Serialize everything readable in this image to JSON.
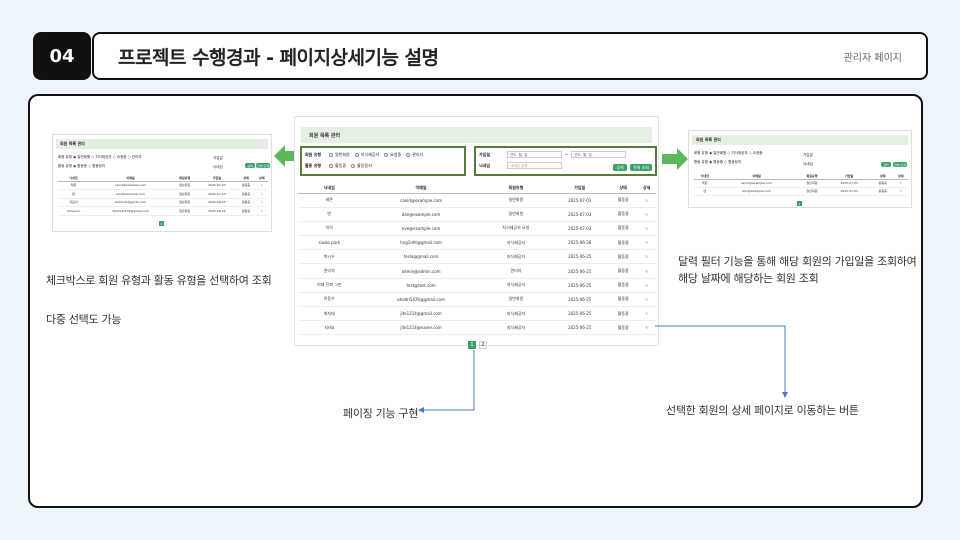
{
  "header": {
    "number": "04",
    "title": "프로젝트 수행경과 - 페이지상세기능 설명",
    "subtitle": "관리자 페이지"
  },
  "screen": {
    "title": "회원 목록 관리",
    "member_type_label": "회원 유형",
    "member_types": [
      "일반회원",
      "지식제공자",
      "요청중",
      "관리자"
    ],
    "activity_type_label": "활동 유형",
    "activity_types": [
      "활동중",
      "활동정지"
    ],
    "join_date_label": "가입일",
    "date_placeholder": "연도. 월. 일.",
    "date_separator": "~",
    "nickname_label": "닉네임",
    "nickname_placeholder": "닉네임 검색",
    "search_button": "검색",
    "reset_button": "전체 조회",
    "columns": [
      "닉네임",
      "이메일",
      "회원유형",
      "가입일",
      "상태",
      "상세"
    ],
    "rows": [
      [
        "레몬",
        "canid@example.com",
        "일반회원",
        "2025-07-03",
        "활동중"
      ],
      [
        "댄",
        "dan@example.com",
        "일반회원",
        "2025-07-03",
        "활동중"
      ],
      [
        "이브",
        "eve@example.com",
        "지식제공자 요청",
        "2025-07-03",
        "활동중"
      ],
      [
        "siwoo park",
        "hng1nht@gmail.com",
        "지식제공자",
        "2025-06-28",
        "활동중"
      ],
      [
        "박시우",
        "tesla@gmail.com",
        "지식제공자",
        "2025-06-25",
        "활동중"
      ],
      [
        "관리자",
        "admin@admin.com",
        "관리자",
        "2025-06-25",
        "활동중"
      ],
      [
        "이제 진짜 그만",
        "test@test.com",
        "지식제공자",
        "2025-06-25",
        "활동중"
      ],
      [
        "이동우",
        "ehddn5476@gmail.com",
        "일반회원",
        "2025-06-25",
        "활동중"
      ],
      [
        "최지태",
        "jite1214@gmail.com",
        "지식제공자",
        "2025-06-25",
        "활동중"
      ],
      [
        "지태a",
        "jite1214@naver.com",
        "지식제공자",
        "2025-06-25",
        "활동중"
      ]
    ],
    "pages": [
      "1",
      "2"
    ],
    "left_rows": [
      [
        "레몬",
        "canid@example.com",
        "일반회원",
        "2025-07-03",
        "활동중"
      ],
      [
        "댄",
        "dan@example.com",
        "일반회원",
        "2025-07-03",
        "활동중"
      ],
      [
        "지묘이",
        "tester01@gmail.com",
        "일반회원",
        "2025-06-25",
        "활동중"
      ],
      [
        "dongwoo",
        "dbstdn0476@gmail.com",
        "일반회원",
        "2025-06-25",
        "활동중"
      ]
    ],
    "right_rows": [
      [
        "레몬",
        "canid@example.com",
        "일반회원",
        "2025-07-03",
        "활동중"
      ],
      [
        "댄",
        "dan@example.com",
        "일반회원",
        "2025-07-03",
        "활동중"
      ]
    ]
  },
  "captions": {
    "left_1": "체크박스로 회원 유형과 활동 유형을 선택하여 조회",
    "left_2": "다중 선택도 가능",
    "right_1": "달력 필터 기능을 통해 해당 회원의 가입일을 조회하여",
    "right_2": "해당 날짜에 해당하는 회원 조회",
    "paging": "페이징 기능 구현",
    "detail": "선택한 회원의 상세 페이지로 이동하는 버튼"
  },
  "colors": {
    "accent": "#3aa06a",
    "outline": "#5a7a3c",
    "arrow": "#5cb85c",
    "pointer": "#4a78c8"
  }
}
